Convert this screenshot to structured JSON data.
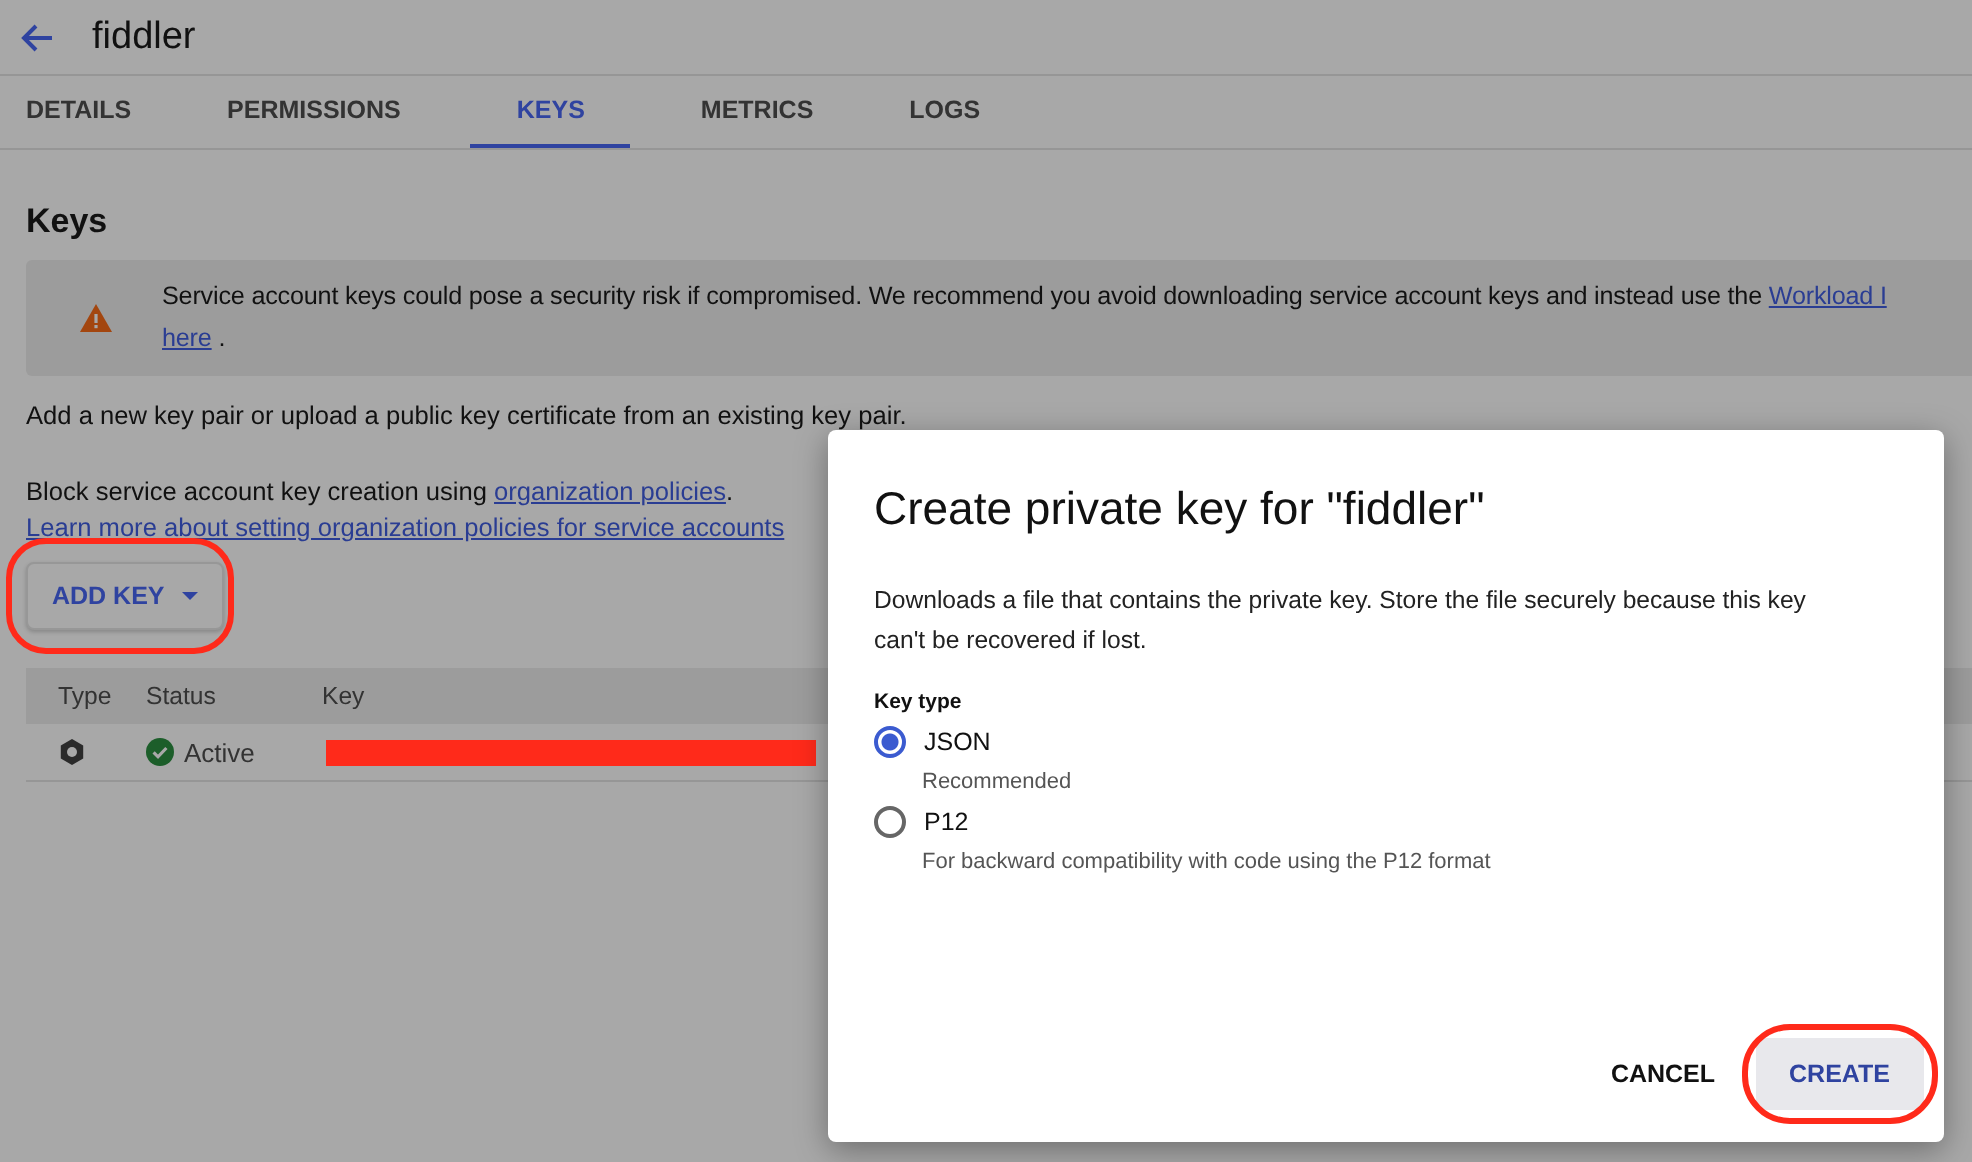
{
  "header": {
    "title": "fiddler"
  },
  "tabs": [
    {
      "label": "DETAILS",
      "selected": false
    },
    {
      "label": "PERMISSIONS",
      "selected": false
    },
    {
      "label": "KEYS",
      "selected": true
    },
    {
      "label": "METRICS",
      "selected": false
    },
    {
      "label": "LOGS",
      "selected": false
    }
  ],
  "section": {
    "heading": "Keys",
    "warning": {
      "text": "Service account keys could pose a security risk if compromised. We recommend you avoid downloading service account keys and instead use the",
      "link": "Workload I",
      "second_link": "here",
      "tail": "."
    },
    "intro": "Add a new key pair or upload a public key certificate from an existing key pair.",
    "policy": {
      "text": "Block service account key creation using",
      "link": "organization policies",
      "tail": "."
    },
    "learn_more": "Learn more about setting organization policies for service accounts",
    "add_key_button": {
      "label": "ADD KEY",
      "highlighted": true
    }
  },
  "table": {
    "columns": [
      "Type",
      "Status",
      "Key"
    ],
    "rows": [
      {
        "status": "Active",
        "key_redacted": true
      }
    ]
  },
  "dialog": {
    "title": "Create private key for \"fiddler\"",
    "description": "Downloads a file that contains the private key. Store the file securely because this key can't be recovered if lost.",
    "key_type_label": "Key type",
    "options": [
      {
        "label": "JSON",
        "hint": "Recommended",
        "selected": true
      },
      {
        "label": "P12",
        "hint": "For backward compatibility with code using the P12 format",
        "selected": false
      }
    ],
    "buttons": [
      {
        "label": "CANCEL",
        "kind": "text",
        "highlighted": false
      },
      {
        "label": "CREATE",
        "kind": "filled",
        "highlighted": true
      }
    ]
  }
}
